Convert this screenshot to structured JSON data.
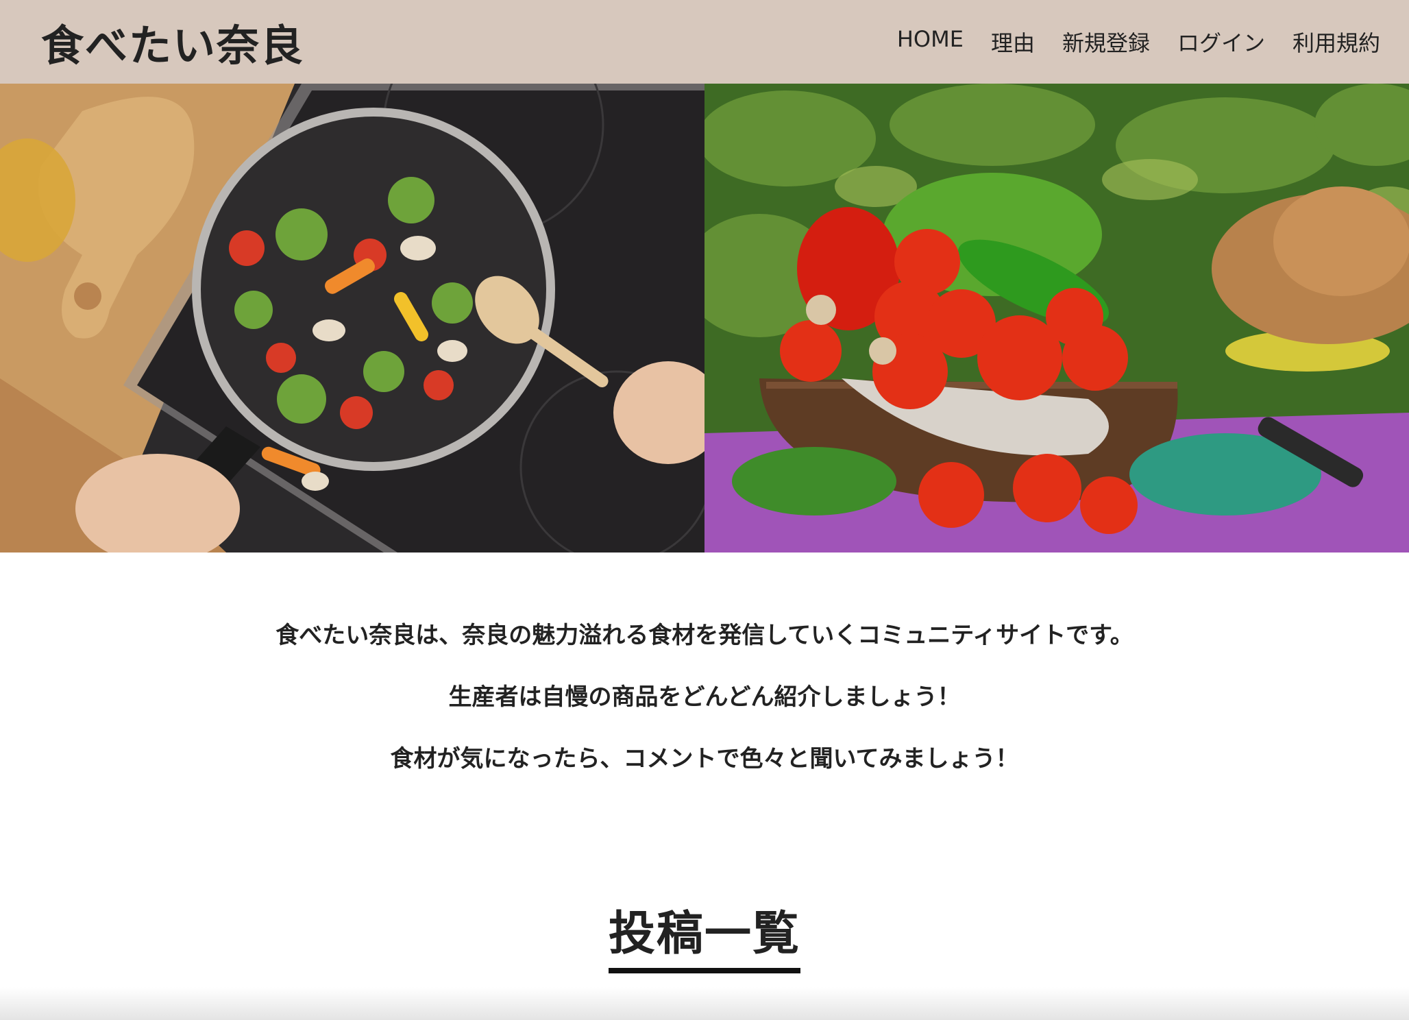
{
  "header": {
    "site_title": "食べたい奈良",
    "nav": [
      {
        "label": "HOME"
      },
      {
        "label": "理由"
      },
      {
        "label": "新規登録"
      },
      {
        "label": "ログイン"
      },
      {
        "label": "利用規約"
      }
    ]
  },
  "hero": {
    "images": [
      {
        "subject": "frying-pan-vegetables"
      },
      {
        "subject": "vegetable-basket-garden"
      }
    ]
  },
  "intro": {
    "lines": [
      "食べたい奈良は、奈良の魅力溢れる食材を発信していくコミュニティサイトです。",
      "生産者は自慢の商品をどんどん紹介しましょう！",
      "食材が気になったら、コメントで色々と聞いてみましょう！"
    ]
  },
  "posts_section": {
    "title": "投稿一覧"
  },
  "colors": {
    "header_bg": "#d7c8bd",
    "text": "#222222"
  }
}
